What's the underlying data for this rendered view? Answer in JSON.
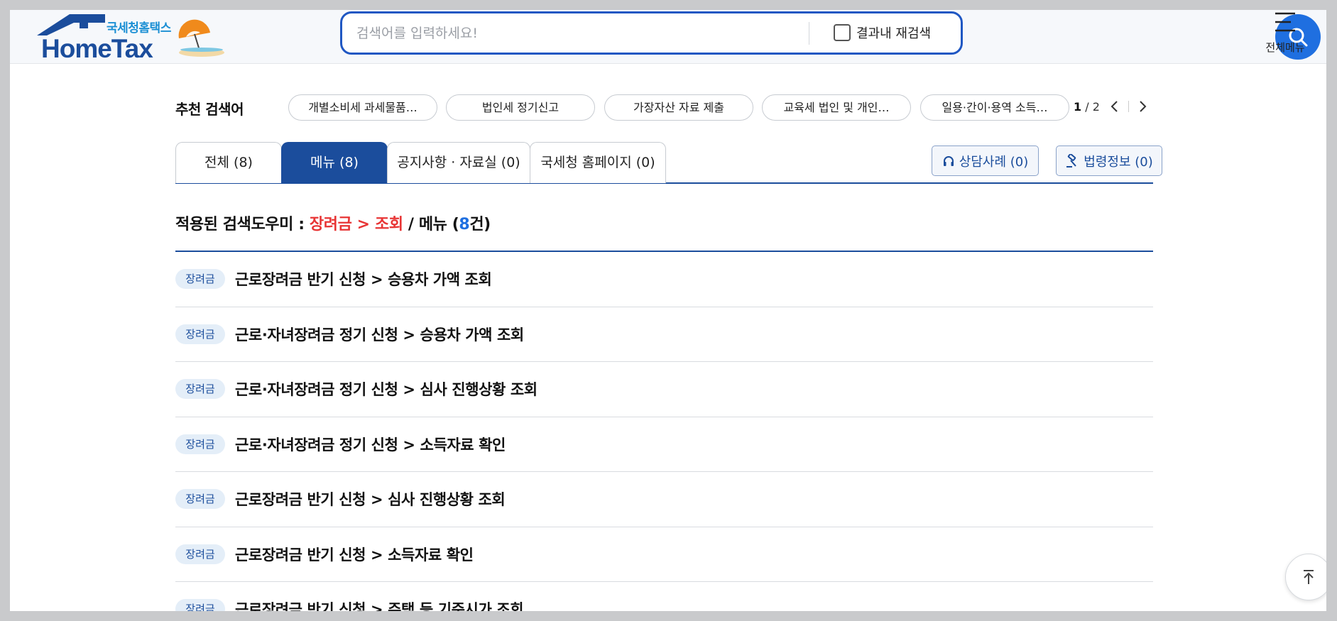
{
  "header": {
    "logo_sub": "국세청홈택스",
    "logo_main": "HomeTax",
    "search": {
      "placeholder": "검색어를 입력하세요!",
      "value": "",
      "recheck_label": "결과내 재검색",
      "recheck_checked": false
    },
    "all_menu_label": "전체메뉴"
  },
  "recommend": {
    "title": "추천 검색어",
    "chips": [
      "개별소비세 과세물품…",
      "법인세 정기신고",
      "가장자산 자료 제출",
      "교육세 법인 및 개인…",
      "일용·간이·용역 소득…"
    ],
    "page_current": "1",
    "page_sep": "/",
    "page_total": "2"
  },
  "tabs": [
    {
      "label": "전체 (8)",
      "active": false
    },
    {
      "label": "메뉴 (8)",
      "active": true
    },
    {
      "label": "공지사항 · 자료실 (0)",
      "active": false
    },
    {
      "label": "국세청 홈페이지 (0)",
      "active": false
    }
  ],
  "side_buttons": {
    "consult": "상담사례 (0)",
    "law": "법령정보 (0)"
  },
  "filter": {
    "prefix": "적용된 검색도우미 : ",
    "path": "장려금 > 조회",
    "middle": " / 메뉴 (",
    "count": "8",
    "suffix": "건)"
  },
  "results": [
    {
      "badge": "장려금",
      "title": "근로장려금 반기 신청 > 승용차 가액 조회"
    },
    {
      "badge": "장려금",
      "title": "근로·자녀장려금 정기 신청 > 승용차 가액 조회"
    },
    {
      "badge": "장려금",
      "title": "근로·자녀장려금 정기 신청 > 심사 진행상황 조회"
    },
    {
      "badge": "장려금",
      "title": "근로·자녀장려금 정기 신청 > 소득자료 확인"
    },
    {
      "badge": "장려금",
      "title": "근로장려금 반기 신청 > 심사 진행상황 조회"
    },
    {
      "badge": "장려금",
      "title": "근로장려금 반기 신청 > 소득자료 확인"
    },
    {
      "badge": "장려금",
      "title": "근로장려금 반기 신청 > 주택 등 기준시가 조회"
    }
  ],
  "colors": {
    "brand_blue": "#1b4d9c",
    "search_blue": "#1f6fe0",
    "highlight_red": "#e83535",
    "badge_bg": "#e4eef8"
  },
  "icons": {
    "search_button": "search-icon",
    "menu": "hamburger-icon",
    "prev": "chevron-left-icon",
    "next": "chevron-right-icon",
    "consult": "headset-icon",
    "law": "gavel-icon",
    "top": "arrow-up-to-top-icon"
  }
}
